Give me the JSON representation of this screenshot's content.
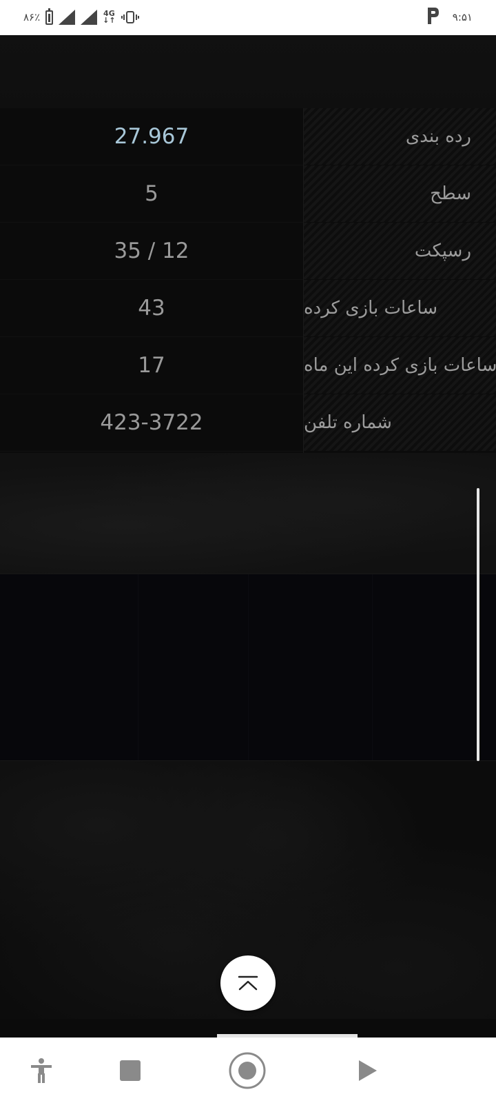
{
  "status_bar": {
    "battery_percent": "۸۶٪",
    "network_type": "4G",
    "time": "۹:۵۱",
    "icons": [
      "battery-icon",
      "signal-icon",
      "signal-icon",
      "network-4g-icon",
      "vibrate-icon",
      "app-notification-icon"
    ]
  },
  "stats": {
    "rows": [
      {
        "label": "رده بندی",
        "value": "27.967",
        "highlight": true
      },
      {
        "label": "سطح",
        "value": "5",
        "highlight": false
      },
      {
        "label": "رسپکت",
        "value": "35 / 12",
        "highlight": false
      },
      {
        "label": "ساعات بازی کرده",
        "value": "43",
        "highlight": false
      },
      {
        "label": "ساعات بازی کرده این ماه",
        "value": "17",
        "highlight": false
      },
      {
        "label": "شماره تلفن",
        "value": "423-3722",
        "highlight": false
      }
    ]
  },
  "scroll_top_button": {
    "icon": "chevron-up-to-top-icon"
  },
  "nav_bar": {
    "icons": [
      "accessibility-icon",
      "stop-icon",
      "record-icon",
      "play-icon"
    ]
  },
  "colors": {
    "background": "#0b0b0b",
    "value_text": "#9a9a9a",
    "highlight_value": "#a8c7d8",
    "label_text": "#9c9c9c",
    "status_bar_bg": "#ffffff",
    "nav_bar_bg": "#ffffff"
  }
}
